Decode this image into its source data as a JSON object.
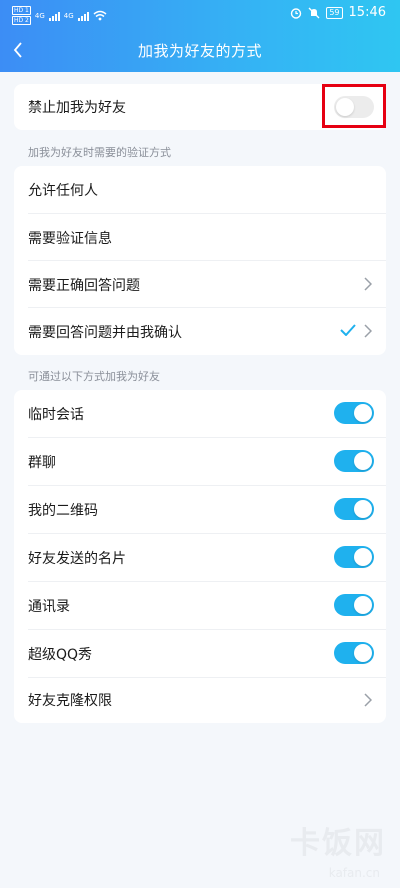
{
  "status_bar": {
    "sim1": "HD 1",
    "sim2": "HD 2",
    "net1": "4G",
    "net2": "4G",
    "battery": "59",
    "time": "15:46"
  },
  "header": {
    "title": "加我为好友的方式"
  },
  "block_friend": {
    "label": "禁止加我为好友",
    "enabled": false
  },
  "verification": {
    "section_label": "加我为好友时需要的验证方式",
    "options": [
      {
        "label": "允许任何人"
      },
      {
        "label": "需要验证信息"
      },
      {
        "label": "需要正确回答问题"
      },
      {
        "label": "需要回答问题并由我确认"
      }
    ]
  },
  "methods": {
    "section_label": "可通过以下方式加我为好友",
    "items": [
      {
        "label": "临时会话",
        "enabled": true
      },
      {
        "label": "群聊",
        "enabled": true
      },
      {
        "label": "我的二维码",
        "enabled": true
      },
      {
        "label": "好友发送的名片",
        "enabled": true
      },
      {
        "label": "通讯录",
        "enabled": true
      },
      {
        "label": "超级QQ秀",
        "enabled": true
      },
      {
        "label": "好友克隆权限"
      }
    ]
  },
  "watermark": {
    "text": "卡饭网",
    "sub": "kafan.cn"
  },
  "colors": {
    "accent": "#1fb1ee",
    "highlight": "#e60012",
    "header_start": "#3c8df5",
    "header_end": "#2fc6f2"
  }
}
